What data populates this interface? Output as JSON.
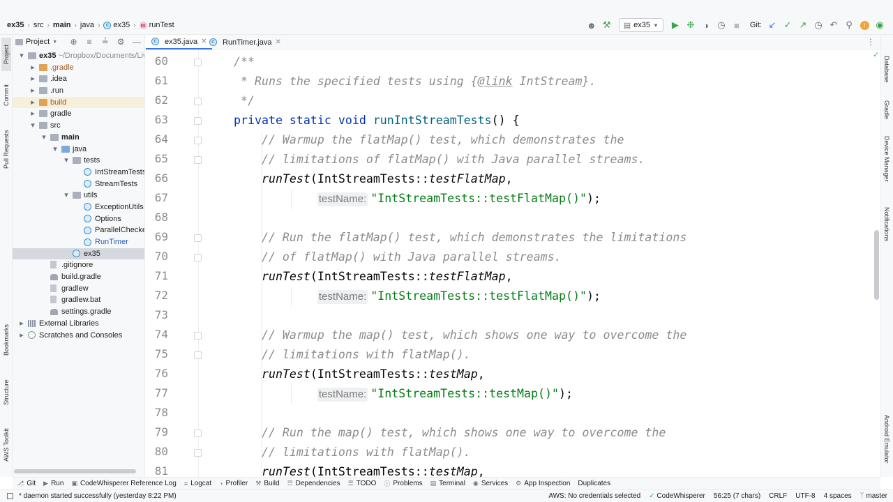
{
  "breadcrumbs": [
    {
      "label": "ex35",
      "icon": "module-icon",
      "bold": true
    },
    {
      "label": "src",
      "icon": "folder-icon",
      "bold": false
    },
    {
      "label": "main",
      "icon": "folder-icon",
      "bold": true
    },
    {
      "label": "java",
      "icon": "folder-icon",
      "bold": false
    },
    {
      "label": "ex35",
      "icon": "class-icon",
      "bold": false
    },
    {
      "label": "runTest",
      "icon": "method-icon",
      "bold": false
    }
  ],
  "toolbar": {
    "run_config": "ex35",
    "git_label": "Git:"
  },
  "project_panel": {
    "title": "Project",
    "tree": [
      {
        "label": "ex35",
        "extra": " ~/Dropbox/Documents/Liv",
        "depth": 0,
        "arrow": "down",
        "icon": "folder",
        "bold": true
      },
      {
        "label": ".gradle",
        "depth": 1,
        "arrow": "right",
        "icon": "folder-orange",
        "color": "orange"
      },
      {
        "label": ".idea",
        "depth": 1,
        "arrow": "right",
        "icon": "folder"
      },
      {
        "label": ".run",
        "depth": 1,
        "arrow": "right",
        "icon": "folder"
      },
      {
        "label": "build",
        "depth": 1,
        "arrow": "right",
        "icon": "folder-orange",
        "color": "orange",
        "highlight": true
      },
      {
        "label": "gradle",
        "depth": 1,
        "arrow": "right",
        "icon": "folder"
      },
      {
        "label": "src",
        "depth": 1,
        "arrow": "down",
        "icon": "folder"
      },
      {
        "label": "main",
        "depth": 2,
        "arrow": "down",
        "icon": "folder",
        "bold": true
      },
      {
        "label": "java",
        "depth": 3,
        "arrow": "down",
        "icon": "folder-blue"
      },
      {
        "label": "tests",
        "depth": 4,
        "arrow": "down",
        "icon": "package"
      },
      {
        "label": "IntStreamTests",
        "depth": 5,
        "arrow": "",
        "icon": "class"
      },
      {
        "label": "StreamTests",
        "depth": 5,
        "arrow": "",
        "icon": "class"
      },
      {
        "label": "utils",
        "depth": 4,
        "arrow": "down",
        "icon": "package"
      },
      {
        "label": "ExceptionUtils",
        "depth": 5,
        "arrow": "",
        "icon": "class"
      },
      {
        "label": "Options",
        "depth": 5,
        "arrow": "",
        "icon": "class"
      },
      {
        "label": "ParallelCheckerU",
        "depth": 5,
        "arrow": "",
        "icon": "class"
      },
      {
        "label": "RunTimer",
        "depth": 5,
        "arrow": "",
        "icon": "class",
        "color": "blue"
      },
      {
        "label": "ex35",
        "depth": 4,
        "arrow": "",
        "icon": "class",
        "selected": true
      },
      {
        "label": ".gitignore",
        "depth": 2,
        "arrow": "",
        "icon": "file"
      },
      {
        "label": "build.gradle",
        "depth": 2,
        "arrow": "",
        "icon": "gradle"
      },
      {
        "label": "gradlew",
        "depth": 2,
        "arrow": "",
        "icon": "file"
      },
      {
        "label": "gradlew.bat",
        "depth": 2,
        "arrow": "",
        "icon": "file"
      },
      {
        "label": "settings.gradle",
        "depth": 2,
        "arrow": "",
        "icon": "gradle"
      },
      {
        "label": "External Libraries",
        "depth": 0,
        "arrow": "right",
        "icon": "library"
      },
      {
        "label": "Scratches and Consoles",
        "depth": 0,
        "arrow": "right",
        "icon": "scratch"
      }
    ]
  },
  "left_tool_tabs": {
    "project": "Project",
    "commit": "Commit",
    "pull_requests": "Pull Requests",
    "bookmarks": "Bookmarks",
    "structure": "Structure",
    "aws_toolkit": "AWS Toolkit"
  },
  "right_tool_tabs": {
    "database": "Database",
    "gradle": "Gradle",
    "device_manager": "Device Manager",
    "notifications": "Notifications",
    "android_emulator": "Android Emulator"
  },
  "editor_tabs": [
    {
      "label": "ex35.java",
      "active": true
    },
    {
      "label": "RunTimer.java",
      "active": false
    }
  ],
  "code": {
    "line_numbers": [
      "60",
      "61",
      "62",
      "63",
      "64",
      "65",
      "66",
      "67",
      "68",
      "69",
      "70",
      "71",
      "72",
      "73",
      "74",
      "75",
      "76",
      "77",
      "78",
      "79",
      "80",
      "81"
    ],
    "lines": [
      [
        {
          "t": "/**",
          "c": "doc"
        }
      ],
      [
        {
          "t": " * Runs the specified tests using ",
          "c": "doc"
        },
        {
          "t": "{",
          "c": "doc"
        },
        {
          "t": "@link",
          "c": "doctag"
        },
        {
          "t": " IntStream",
          "c": "doc"
        },
        {
          "t": "}.",
          "c": "doc"
        }
      ],
      [
        {
          "t": " */",
          "c": "doc"
        }
      ],
      [
        {
          "t": "private static void ",
          "c": "kw"
        },
        {
          "t": "runIntStreamTests",
          "c": "fn"
        },
        {
          "t": "() {",
          "c": ""
        }
      ],
      [
        {
          "t": "    // Warmup the flatMap() test, which demonstrates the",
          "c": "cm"
        }
      ],
      [
        {
          "t": "    // limitations of flatMap() with Java parallel streams.",
          "c": "cm"
        }
      ],
      [
        {
          "t": "    ",
          "c": ""
        },
        {
          "t": "runTest",
          "c": "it"
        },
        {
          "t": "(IntStreamTests::",
          "c": ""
        },
        {
          "t": "testFlatMap",
          "c": "it"
        },
        {
          "t": ",",
          "c": ""
        }
      ],
      [
        {
          "t": "            ",
          "c": ""
        },
        {
          "t": "testName:",
          "c": "hint"
        },
        {
          "t": "\"IntStreamTests::testFlatMap()\"",
          "c": "str"
        },
        {
          "t": ");",
          "c": ""
        }
      ],
      [],
      [
        {
          "t": "    // Run the flatMap() test, which demonstrates the limitations",
          "c": "cm"
        }
      ],
      [
        {
          "t": "    // of flatMap() with Java parallel streams.",
          "c": "cm"
        }
      ],
      [
        {
          "t": "    ",
          "c": ""
        },
        {
          "t": "runTest",
          "c": "it"
        },
        {
          "t": "(IntStreamTests::",
          "c": ""
        },
        {
          "t": "testFlatMap",
          "c": "it"
        },
        {
          "t": ",",
          "c": ""
        }
      ],
      [
        {
          "t": "            ",
          "c": ""
        },
        {
          "t": "testName:",
          "c": "hint"
        },
        {
          "t": "\"IntStreamTests::testFlatMap()\"",
          "c": "str"
        },
        {
          "t": ");",
          "c": ""
        }
      ],
      [],
      [
        {
          "t": "    // Warmup the map() test, which shows one way to overcome the",
          "c": "cm"
        }
      ],
      [
        {
          "t": "    // limitations with flatMap().",
          "c": "cm"
        }
      ],
      [
        {
          "t": "    ",
          "c": ""
        },
        {
          "t": "runTest",
          "c": "it"
        },
        {
          "t": "(IntStreamTests::",
          "c": ""
        },
        {
          "t": "testMap",
          "c": "it"
        },
        {
          "t": ",",
          "c": ""
        }
      ],
      [
        {
          "t": "            ",
          "c": ""
        },
        {
          "t": "testName:",
          "c": "hint"
        },
        {
          "t": "\"IntStreamTests::testMap()\"",
          "c": "str"
        },
        {
          "t": ");",
          "c": ""
        }
      ],
      [],
      [
        {
          "t": "    // Run the map() test, which shows one way to overcome the",
          "c": "cm"
        }
      ],
      [
        {
          "t": "    // limitations with flatMap().",
          "c": "cm"
        }
      ],
      [
        {
          "t": "    ",
          "c": ""
        },
        {
          "t": "runTest",
          "c": "it"
        },
        {
          "t": "(IntStreamTests::",
          "c": ""
        },
        {
          "t": "testMap",
          "c": "it"
        },
        {
          "t": ",",
          "c": ""
        }
      ]
    ]
  },
  "bottom_tools": [
    {
      "label": "Git",
      "icon": "git-icon"
    },
    {
      "label": "Run",
      "icon": "run-icon"
    },
    {
      "label": "CodeWhisperer Reference Log",
      "icon": "codewhisperer-icon"
    },
    {
      "label": "Logcat",
      "icon": "logcat-icon"
    },
    {
      "label": "Profiler",
      "icon": "profiler-icon"
    },
    {
      "label": "Build",
      "icon": "build-icon"
    },
    {
      "label": "Dependencies",
      "icon": "dependencies-icon"
    },
    {
      "label": "TODO",
      "icon": "todo-icon"
    },
    {
      "label": "Problems",
      "icon": "problems-icon"
    },
    {
      "label": "Terminal",
      "icon": "terminal-icon"
    },
    {
      "label": "Services",
      "icon": "services-icon"
    },
    {
      "label": "App Inspection",
      "icon": "app-inspection-icon"
    },
    {
      "label": "Duplicates",
      "icon": ""
    }
  ],
  "status": {
    "message": "* daemon started successfully (yesterday 8:22 PM)",
    "aws": "AWS: No credentials selected",
    "codewhisperer": "CodeWhisperer",
    "position": "56:25 (7 chars)",
    "line_sep": "CRLF",
    "encoding": "UTF-8",
    "indent": "4 spaces",
    "branch": "master"
  },
  "colors": {
    "keyword": "#0033b3",
    "method": "#00627a",
    "string": "#067d17",
    "comment": "#8c8c8c",
    "accent": "#3574f0"
  }
}
